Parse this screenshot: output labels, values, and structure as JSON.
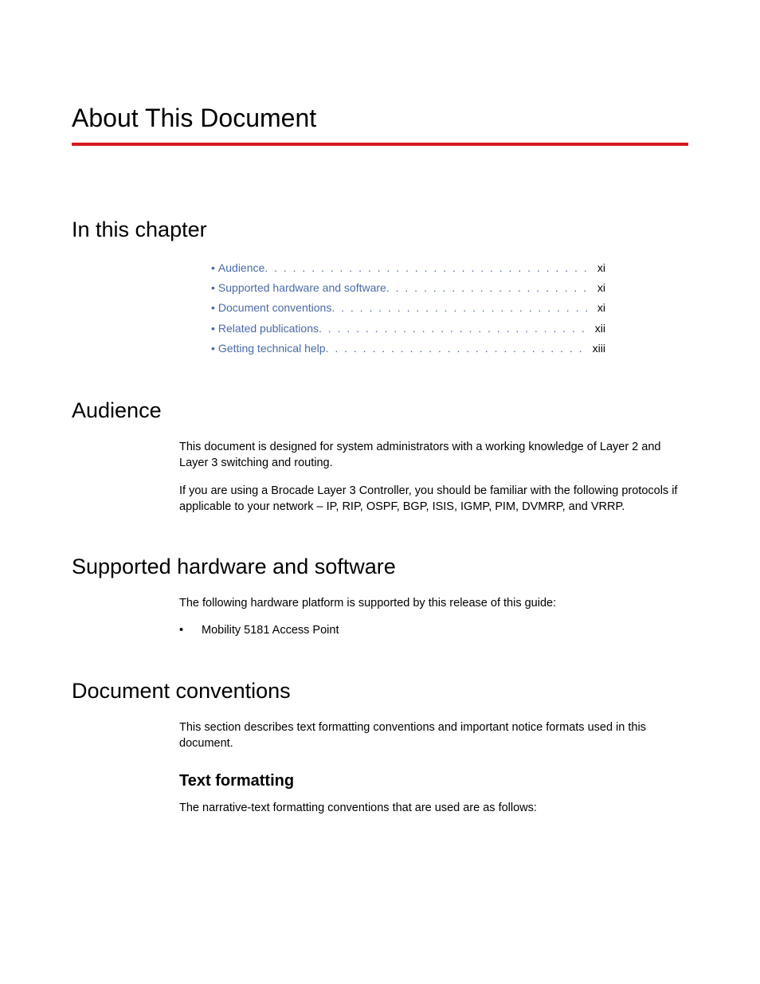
{
  "title": "About This Document",
  "sections": {
    "in_chapter": {
      "heading": "In this chapter",
      "items": [
        {
          "label": "Audience",
          "page": "xi"
        },
        {
          "label": "Supported hardware and software",
          "page": "xi"
        },
        {
          "label": "Document conventions",
          "page": "xi"
        },
        {
          "label": "Related publications",
          "page": "xii"
        },
        {
          "label": "Getting technical help",
          "page": "xiii"
        }
      ]
    },
    "audience": {
      "heading": "Audience",
      "paragraphs": [
        "This document is designed for system administrators with a working knowledge of Layer 2 and Layer 3 switching and routing.",
        "If you are using a Brocade Layer 3 Controller, you should be familiar with the following protocols if applicable to your network – IP, RIP, OSPF, BGP, ISIS, IGMP, PIM, DVMRP, and VRRP."
      ]
    },
    "supported": {
      "heading": "Supported hardware and software",
      "intro": "The following hardware platform is supported by this release of this guide:",
      "bullets": [
        "Mobility 5181 Access Point"
      ]
    },
    "conventions": {
      "heading": "Document conventions",
      "intro": "This section describes text formatting conventions and important notice formats used in this document.",
      "sub": {
        "heading": "Text formatting",
        "intro": "The narrative-text formatting conventions that are used are as follows:"
      }
    }
  }
}
